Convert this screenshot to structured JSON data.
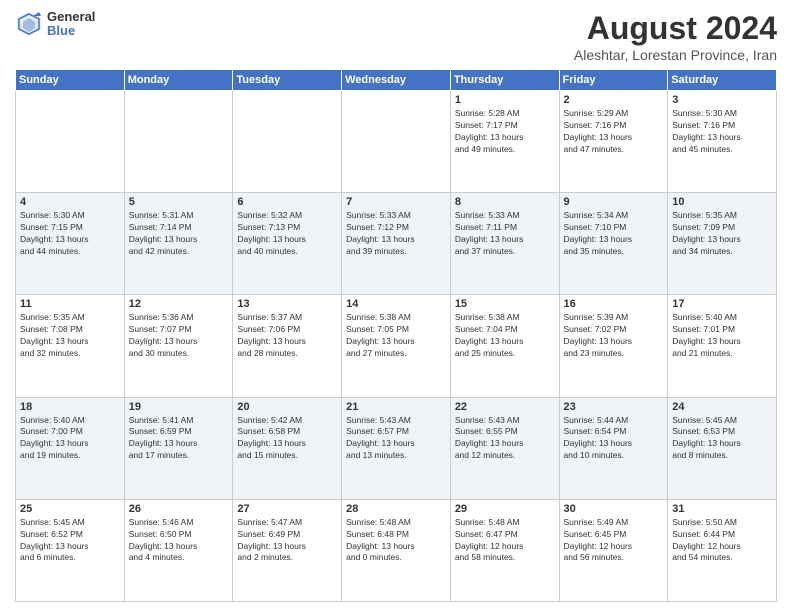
{
  "logo": {
    "general": "General",
    "blue": "Blue"
  },
  "title": {
    "month": "August 2024",
    "location": "Aleshtar, Lorestan Province, Iran"
  },
  "headers": [
    "Sunday",
    "Monday",
    "Tuesday",
    "Wednesday",
    "Thursday",
    "Friday",
    "Saturday"
  ],
  "weeks": [
    [
      {
        "day": "",
        "info": ""
      },
      {
        "day": "",
        "info": ""
      },
      {
        "day": "",
        "info": ""
      },
      {
        "day": "",
        "info": ""
      },
      {
        "day": "1",
        "info": "Sunrise: 5:28 AM\nSunset: 7:17 PM\nDaylight: 13 hours\nand 49 minutes."
      },
      {
        "day": "2",
        "info": "Sunrise: 5:29 AM\nSunset: 7:16 PM\nDaylight: 13 hours\nand 47 minutes."
      },
      {
        "day": "3",
        "info": "Sunrise: 5:30 AM\nSunset: 7:16 PM\nDaylight: 13 hours\nand 45 minutes."
      }
    ],
    [
      {
        "day": "4",
        "info": "Sunrise: 5:30 AM\nSunset: 7:15 PM\nDaylight: 13 hours\nand 44 minutes."
      },
      {
        "day": "5",
        "info": "Sunrise: 5:31 AM\nSunset: 7:14 PM\nDaylight: 13 hours\nand 42 minutes."
      },
      {
        "day": "6",
        "info": "Sunrise: 5:32 AM\nSunset: 7:13 PM\nDaylight: 13 hours\nand 40 minutes."
      },
      {
        "day": "7",
        "info": "Sunrise: 5:33 AM\nSunset: 7:12 PM\nDaylight: 13 hours\nand 39 minutes."
      },
      {
        "day": "8",
        "info": "Sunrise: 5:33 AM\nSunset: 7:11 PM\nDaylight: 13 hours\nand 37 minutes."
      },
      {
        "day": "9",
        "info": "Sunrise: 5:34 AM\nSunset: 7:10 PM\nDaylight: 13 hours\nand 35 minutes."
      },
      {
        "day": "10",
        "info": "Sunrise: 5:35 AM\nSunset: 7:09 PM\nDaylight: 13 hours\nand 34 minutes."
      }
    ],
    [
      {
        "day": "11",
        "info": "Sunrise: 5:35 AM\nSunset: 7:08 PM\nDaylight: 13 hours\nand 32 minutes."
      },
      {
        "day": "12",
        "info": "Sunrise: 5:36 AM\nSunset: 7:07 PM\nDaylight: 13 hours\nand 30 minutes."
      },
      {
        "day": "13",
        "info": "Sunrise: 5:37 AM\nSunset: 7:06 PM\nDaylight: 13 hours\nand 28 minutes."
      },
      {
        "day": "14",
        "info": "Sunrise: 5:38 AM\nSunset: 7:05 PM\nDaylight: 13 hours\nand 27 minutes."
      },
      {
        "day": "15",
        "info": "Sunrise: 5:38 AM\nSunset: 7:04 PM\nDaylight: 13 hours\nand 25 minutes."
      },
      {
        "day": "16",
        "info": "Sunrise: 5:39 AM\nSunset: 7:02 PM\nDaylight: 13 hours\nand 23 minutes."
      },
      {
        "day": "17",
        "info": "Sunrise: 5:40 AM\nSunset: 7:01 PM\nDaylight: 13 hours\nand 21 minutes."
      }
    ],
    [
      {
        "day": "18",
        "info": "Sunrise: 5:40 AM\nSunset: 7:00 PM\nDaylight: 13 hours\nand 19 minutes."
      },
      {
        "day": "19",
        "info": "Sunrise: 5:41 AM\nSunset: 6:59 PM\nDaylight: 13 hours\nand 17 minutes."
      },
      {
        "day": "20",
        "info": "Sunrise: 5:42 AM\nSunset: 6:58 PM\nDaylight: 13 hours\nand 15 minutes."
      },
      {
        "day": "21",
        "info": "Sunrise: 5:43 AM\nSunset: 6:57 PM\nDaylight: 13 hours\nand 13 minutes."
      },
      {
        "day": "22",
        "info": "Sunrise: 5:43 AM\nSunset: 6:55 PM\nDaylight: 13 hours\nand 12 minutes."
      },
      {
        "day": "23",
        "info": "Sunrise: 5:44 AM\nSunset: 6:54 PM\nDaylight: 13 hours\nand 10 minutes."
      },
      {
        "day": "24",
        "info": "Sunrise: 5:45 AM\nSunset: 6:53 PM\nDaylight: 13 hours\nand 8 minutes."
      }
    ],
    [
      {
        "day": "25",
        "info": "Sunrise: 5:45 AM\nSunset: 6:52 PM\nDaylight: 13 hours\nand 6 minutes."
      },
      {
        "day": "26",
        "info": "Sunrise: 5:46 AM\nSunset: 6:50 PM\nDaylight: 13 hours\nand 4 minutes."
      },
      {
        "day": "27",
        "info": "Sunrise: 5:47 AM\nSunset: 6:49 PM\nDaylight: 13 hours\nand 2 minutes."
      },
      {
        "day": "28",
        "info": "Sunrise: 5:48 AM\nSunset: 6:48 PM\nDaylight: 13 hours\nand 0 minutes."
      },
      {
        "day": "29",
        "info": "Sunrise: 5:48 AM\nSunset: 6:47 PM\nDaylight: 12 hours\nand 58 minutes."
      },
      {
        "day": "30",
        "info": "Sunrise: 5:49 AM\nSunset: 6:45 PM\nDaylight: 12 hours\nand 56 minutes."
      },
      {
        "day": "31",
        "info": "Sunrise: 5:50 AM\nSunset: 6:44 PM\nDaylight: 12 hours\nand 54 minutes."
      }
    ]
  ]
}
